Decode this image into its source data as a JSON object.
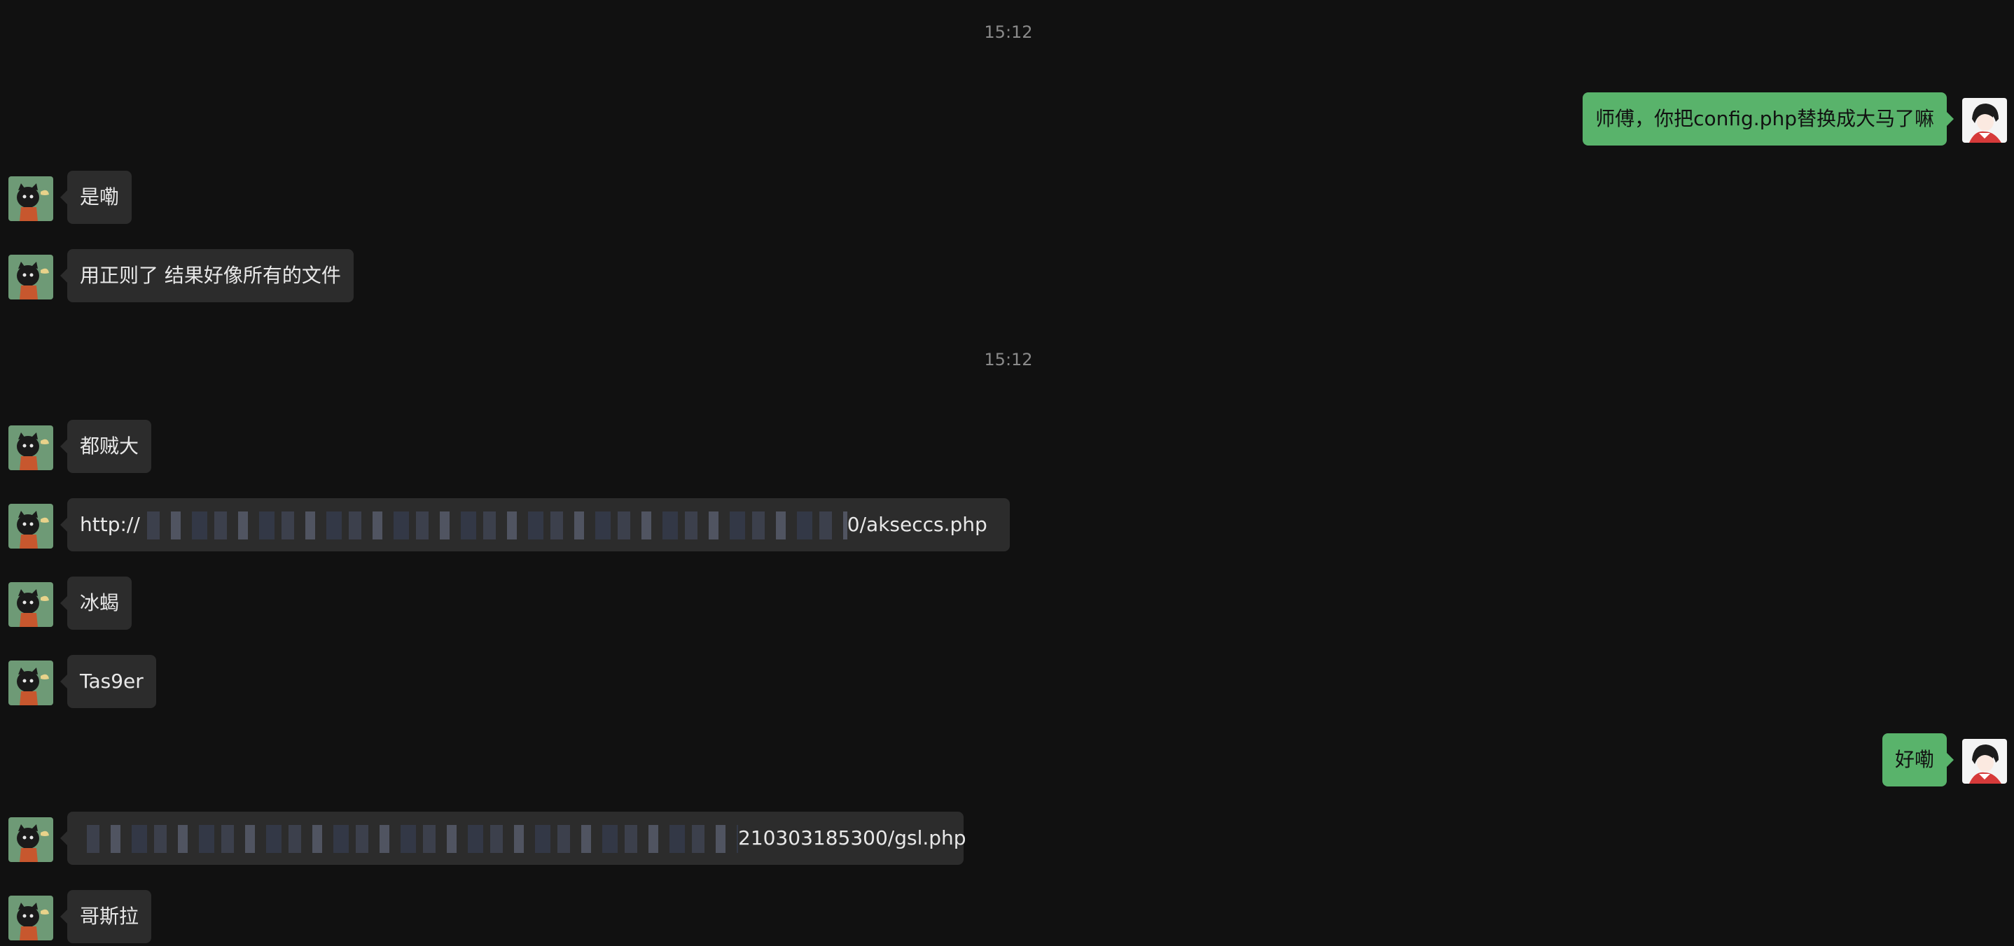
{
  "chat": {
    "timestamps": [
      "15:12",
      "15:12"
    ],
    "messages": [
      {
        "side": "right",
        "text": "师傅，你把config.php替换成大马了嘛"
      },
      {
        "side": "left",
        "text": "是嘞"
      },
      {
        "side": "left",
        "text": "用正则了 结果好像所有的文件"
      },
      {
        "side": "left",
        "text": "都贼大"
      },
      {
        "side": "left",
        "prefix": "http://",
        "suffix": "0/akseccs.php",
        "redacted": true
      },
      {
        "side": "left",
        "text": "冰蝎"
      },
      {
        "side": "left",
        "text": "Tas9er"
      },
      {
        "side": "right",
        "text": "好嘞"
      },
      {
        "side": "left",
        "suffix": "210303185300/gsl.php",
        "redacted": true
      },
      {
        "side": "left",
        "text": "哥斯拉"
      }
    ]
  },
  "colors": {
    "background": "#111111",
    "incoming_bubble": "#2c2c2c",
    "outgoing_bubble": "#59b36b",
    "timestamp": "#8a8a8a"
  },
  "icons": {
    "incoming_avatar": "cartoon-cat-avatar-icon",
    "outgoing_avatar": "anime-character-avatar-icon"
  }
}
